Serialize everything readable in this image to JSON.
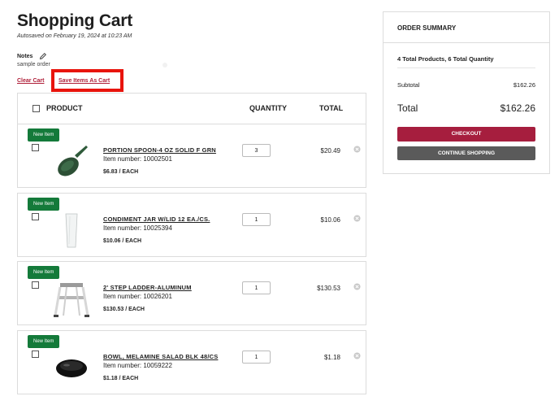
{
  "page": {
    "title": "Shopping Cart",
    "autosaved": "Autosaved on February 19, 2024 at 10:23 AM",
    "notes_label": "Notes",
    "notes_value": "sample order",
    "clear_cart": "Clear Cart",
    "save_as_cart": "Save Items As Cart"
  },
  "table": {
    "headers": {
      "product": "PRODUCT",
      "quantity": "QUANTITY",
      "total": "TOTAL"
    }
  },
  "items": [
    {
      "badge": "New Item",
      "name": "PORTION SPOON-4 OZ SOLID F GRN",
      "item_number": "Item number: 10002501",
      "unit_price": "$6.83 / EACH",
      "quantity": "3",
      "total": "$20.49",
      "image_icon": "green-portion-spoon"
    },
    {
      "badge": "New Item",
      "name": "CONDIMENT JAR W/LID 12 EA./CS.",
      "item_number": "Item number: 10025394",
      "unit_price": "$10.06 / EACH",
      "quantity": "1",
      "total": "$10.06",
      "image_icon": "clear-glass-jar"
    },
    {
      "badge": "New Item",
      "name": "2' STEP LADDER-ALUMINUM",
      "item_number": "Item number: 10026201",
      "unit_price": "$130.53 / EACH",
      "quantity": "1",
      "total": "$130.53",
      "image_icon": "step-ladder"
    },
    {
      "badge": "New Item",
      "name": "BOWL, MELAMINE SALAD BLK 48/CS",
      "item_number": "Item number: 10059222",
      "unit_price": "$1.18 / EACH",
      "quantity": "1",
      "total": "$1.18",
      "image_icon": "black-bowl"
    }
  ],
  "summary": {
    "title": "ORDER SUMMARY",
    "counts": "4 Total Products, 6 Total Quantity",
    "subtotal_label": "Subtotal",
    "subtotal_value": "$162.26",
    "total_label": "Total",
    "total_value": "$162.26",
    "checkout": "CHECKOUT",
    "continue": "CONTINUE SHOPPING"
  },
  "colors": {
    "brand_red": "#a61e3e",
    "badge_green": "#147a3a",
    "highlight_red": "#e8140c",
    "continue_gray": "#5a5a5a"
  }
}
